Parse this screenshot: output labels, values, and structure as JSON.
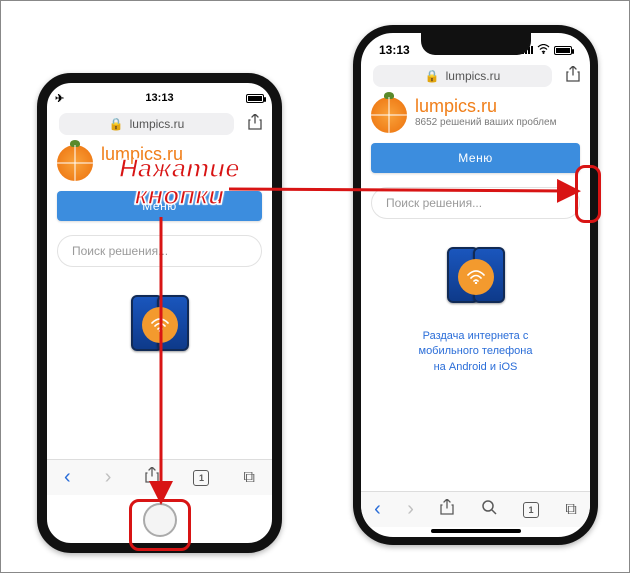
{
  "annotation": {
    "text_line1": "Нажатие",
    "text_line2": "кнопки"
  },
  "left_phone": {
    "status": {
      "time": "13:13",
      "airplane_icon": "✈",
      "battery_icon": "battery"
    },
    "address": {
      "lock_icon": "🔒",
      "domain": "lumpics.ru",
      "share_icon": "share"
    },
    "site": {
      "name": "lumpics.ru",
      "menu_label": "Меню",
      "search_placeholder": "Поиск решения..."
    },
    "toolbar": {
      "back": "‹",
      "forward": "›",
      "share": "share",
      "tabs_label": "1",
      "tabs2_label": "⧉"
    }
  },
  "right_phone": {
    "status": {
      "time": "13:13"
    },
    "address": {
      "lock_icon": "🔒",
      "domain": "lumpics.ru"
    },
    "site": {
      "name": "lumpics.ru",
      "tagline": "8652 решений ваших проблем",
      "menu_label": "Меню",
      "search_placeholder": "Поиск решения..."
    },
    "article": {
      "line1": "Раздача интернета с",
      "line2": "мобильного телефона",
      "line3": "на Android и iOS"
    },
    "toolbar": {
      "back": "‹",
      "forward": "›",
      "share": "share",
      "search": "search",
      "tabs_label": "1",
      "tabs2": "⧉"
    }
  }
}
